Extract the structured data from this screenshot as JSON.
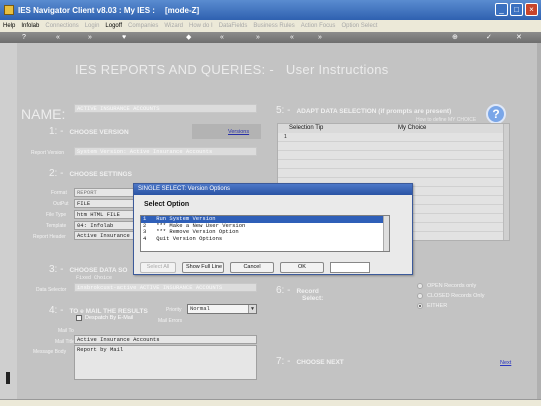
{
  "window": {
    "title": "IES Navigator Client v8.03 : My IES :",
    "mode": "[mode-Z]"
  },
  "menu": [
    {
      "label": "Help",
      "enabled": true
    },
    {
      "label": "Infolab",
      "enabled": true
    },
    {
      "label": "Connections",
      "enabled": false
    },
    {
      "label": "Login",
      "enabled": false
    },
    {
      "label": "Logoff",
      "enabled": true
    },
    {
      "label": "Companies",
      "enabled": false
    },
    {
      "label": "Wizard",
      "enabled": false
    },
    {
      "label": "How do I",
      "enabled": false
    },
    {
      "label": "DataFields",
      "enabled": false
    },
    {
      "label": "Business Rules",
      "enabled": false
    },
    {
      "label": "Action Focus",
      "enabled": false
    },
    {
      "label": "Option Select",
      "enabled": false
    }
  ],
  "toolbar": {
    "items": [
      "?",
      "«",
      "»",
      "♥",
      "◆",
      "«",
      "»",
      "«",
      "»",
      "⊕",
      "✓",
      "✕"
    ]
  },
  "page": {
    "heading": "IES REPORTS AND QUERIES: -",
    "subheading": "User Instructions",
    "name_label": "NAME:",
    "name_value": "ACTIVE INSURANCE ACCOUNTS"
  },
  "step1": {
    "number": "1: -",
    "title": "CHOOSE VERSION",
    "versions_link": "Versions",
    "report_version_label": "Report Version",
    "report_version_value": "System Version: Active Insurance Accounts"
  },
  "step2": {
    "number": "2: -",
    "title": "CHOOSE SETTINGS",
    "rows": [
      {
        "label": "Format",
        "value": "REPORT"
      },
      {
        "label": "OutPut",
        "value": "FILE"
      },
      {
        "label": "File Type",
        "value": "htm HTML FILE"
      },
      {
        "label": "Template",
        "value": "04: Infolab"
      },
      {
        "label": "Report Header",
        "value": "Active Insurance"
      }
    ]
  },
  "step3": {
    "number": "3: -",
    "title": "CHOOSE DATA SO",
    "sub": "Fixed Choice",
    "data_selector_label": "Data Selector",
    "data_selector_value": "insbrokcust-active ACTIVE INSURANCE ACCOUNTS"
  },
  "step4": {
    "number": "4: -",
    "title": "TO e MAIL THE RESULTS",
    "priority_label": "Priority",
    "priority_value": "Normal",
    "despatch_label": "Despatch By E-Mail",
    "mail_errors_label": "Mail Errors",
    "mail_to_label": "Mail To",
    "mail_title_label": "Mail Title",
    "mail_title_value": "Active Insurance Accounts",
    "message_body_label": "Message Body",
    "message_body_value": "Report by Mail"
  },
  "step5": {
    "number": "5: -",
    "title": "ADAPT DATA SELECTION (if prompts are present)",
    "help_link": "How to define MY CHOICE",
    "col_tip": "Selection Tip",
    "col_choice": "My Choice",
    "first_row_num": "1"
  },
  "step6": {
    "number": "6: -",
    "title": "Record",
    "select_label": "Select:",
    "options": [
      "OPEN Records only",
      "CLOSED Records Only",
      "EITHER"
    ],
    "selected_index": 2
  },
  "step7": {
    "number": "7: -",
    "title": "CHOOSE NEXT",
    "next_link": "Next"
  },
  "dialog": {
    "title": "SINGLE SELECT: Version Options",
    "heading": "Select Option",
    "options": [
      "1   Run System Version",
      "2   *** Make a New User Version",
      "3   *** Remove Version Option",
      "4   Quit Version Options"
    ],
    "selected_index": 0,
    "buttons": {
      "select_all": "Select All",
      "show_full_line": "Show Full Line",
      "cancel": "Cancel",
      "ok": "OK"
    }
  }
}
